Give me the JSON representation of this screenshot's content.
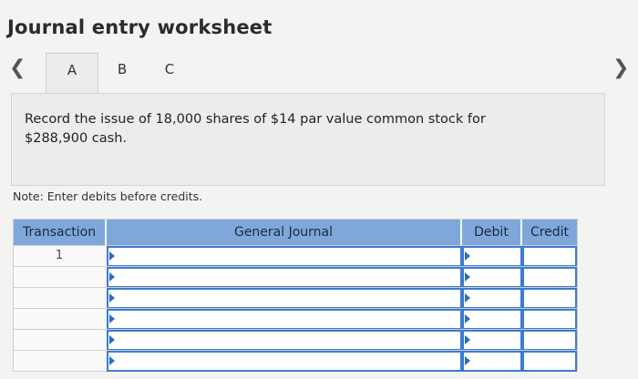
{
  "title": "Journal entry worksheet",
  "nav": {
    "prev_icon": "chevron-left-icon",
    "next_icon": "chevron-right-icon"
  },
  "tabs": [
    {
      "label": "A",
      "active": true
    },
    {
      "label": "B",
      "active": false
    },
    {
      "label": "C",
      "active": false
    }
  ],
  "prompt": "Record the issue of 18,000 shares of $14 par value common stock for $288,900 cash.",
  "note": "Note: Enter debits before credits.",
  "table": {
    "headers": {
      "transaction": "Transaction",
      "general_journal": "General Journal",
      "debit": "Debit",
      "credit": "Credit"
    },
    "rows": [
      {
        "transaction": "1",
        "general_journal": "",
        "debit": "",
        "credit": ""
      },
      {
        "transaction": "",
        "general_journal": "",
        "debit": "",
        "credit": ""
      },
      {
        "transaction": "",
        "general_journal": "",
        "debit": "",
        "credit": ""
      },
      {
        "transaction": "",
        "general_journal": "",
        "debit": "",
        "credit": ""
      },
      {
        "transaction": "",
        "general_journal": "",
        "debit": "",
        "credit": ""
      },
      {
        "transaction": "",
        "general_journal": "",
        "debit": "",
        "credit": ""
      }
    ]
  },
  "colors": {
    "header_bg": "#7fa7d9",
    "input_border": "#3a7bd5",
    "page_bg": "#f3f3f1"
  }
}
